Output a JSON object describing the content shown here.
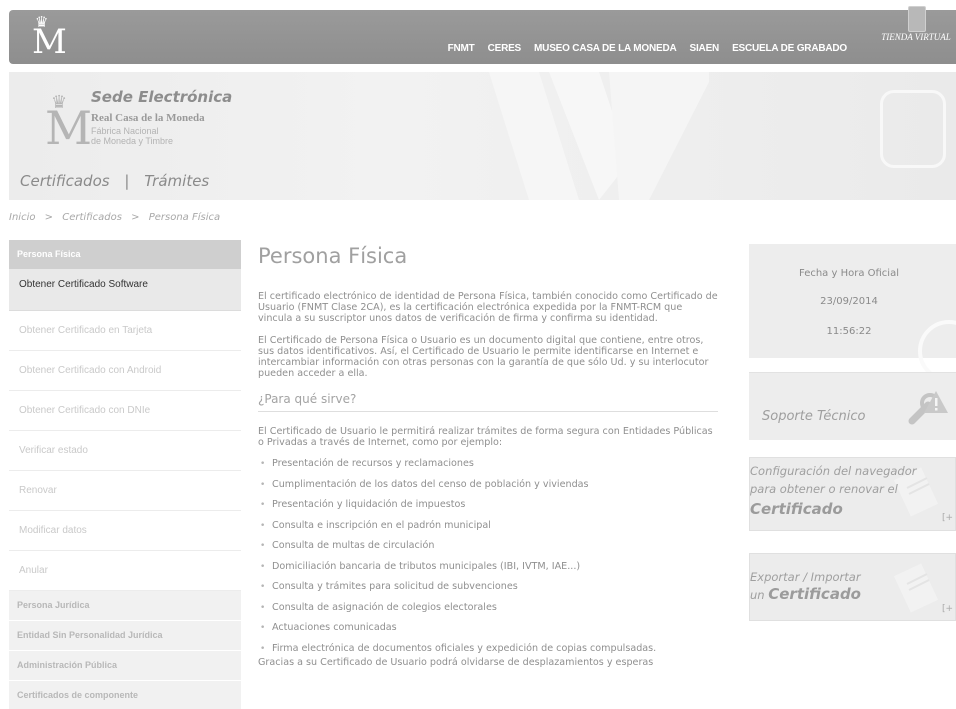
{
  "top_nav": [
    "FNMT",
    "CERES",
    "MUSEO CASA DE LA MONEDA",
    "SIAEN",
    "ESCUELA DE GRABADO"
  ],
  "tienda": "TIENDA VIRTUAL",
  "brand": {
    "sede": "Sede Electrónica",
    "rcm": "Real Casa de la Moneda",
    "fab_line1": "Fábrica Nacional",
    "fab_line2": "de Moneda y Timbre"
  },
  "sections": {
    "certificados": "Certificados",
    "sep": "|",
    "tramites": "Trámites"
  },
  "breadcrumb": [
    "Inicio",
    ">",
    "Certificados",
    ">",
    "Persona Física"
  ],
  "sidebar": {
    "header": "Persona Física",
    "items": [
      "Obtener Certificado Software",
      "Obtener Certificado en Tarjeta",
      "Obtener Certificado con Android",
      "Obtener Certificado con DNIe",
      "Verificar estado",
      "Renovar",
      "Modificar datos",
      "Anular"
    ],
    "categories": [
      "Persona Jurídica",
      "Entidad Sin Personalidad Jurídica",
      "Administración Pública",
      "Certificados de componente"
    ]
  },
  "main": {
    "title": "Persona Física",
    "p1": "El certificado electrónico de identidad de Persona Física, también conocido como Certificado de Usuario (FNMT Clase 2CA), es la certificación electrónica expedida por la FNMT-RCM que vincula a su suscriptor unos datos de verificación de firma y confirma su identidad.",
    "p2": "El Certificado de Persona Física o Usuario es un documento digital que contiene, entre otros, sus datos identificativos. Así, el Certificado de Usuario le permite identificarse en Internet e intercambiar información con otras personas con la garantía de que sólo Ud. y su interlocutor pueden acceder a ella.",
    "subtitle": "¿Para qué sirve?",
    "p3": "El Certificado de Usuario le permitirá realizar trámites de forma segura con Entidades Públicas o Privadas a través de Internet, como por ejemplo:",
    "uses": [
      "Presentación de recursos y reclamaciones",
      "Cumplimentación de los datos del censo de población y viviendas",
      "Presentación y liquidación de impuestos",
      "Consulta e inscripción en el padrón municipal",
      "Consulta de multas de circulación",
      "Domiciliación bancaria de tributos municipales (IBI, IVTM, IAE...)",
      "Consulta y trámites para solicitud de subvenciones",
      "Consulta de asignación de colegios electorales",
      "Actuaciones comunicadas",
      "Firma electrónica de documentos oficiales y expedición de copias compulsadas."
    ],
    "p4": "Gracias a su Certificado de Usuario podrá olvidarse de desplazamientos y esperas"
  },
  "clock": {
    "label": "Fecha y Hora Oficial",
    "date": "23/09/2014",
    "time": "11:56:22"
  },
  "soporte": "Soporte Técnico",
  "promo_config": {
    "line1": "Configuración del navegador",
    "line2": "para obtener o renovar el",
    "big": "Certificado",
    "more": "[+"
  },
  "promo_export": {
    "line1": "Exportar / Importar",
    "line2": "un",
    "big": "Certificado",
    "more": "[+"
  }
}
